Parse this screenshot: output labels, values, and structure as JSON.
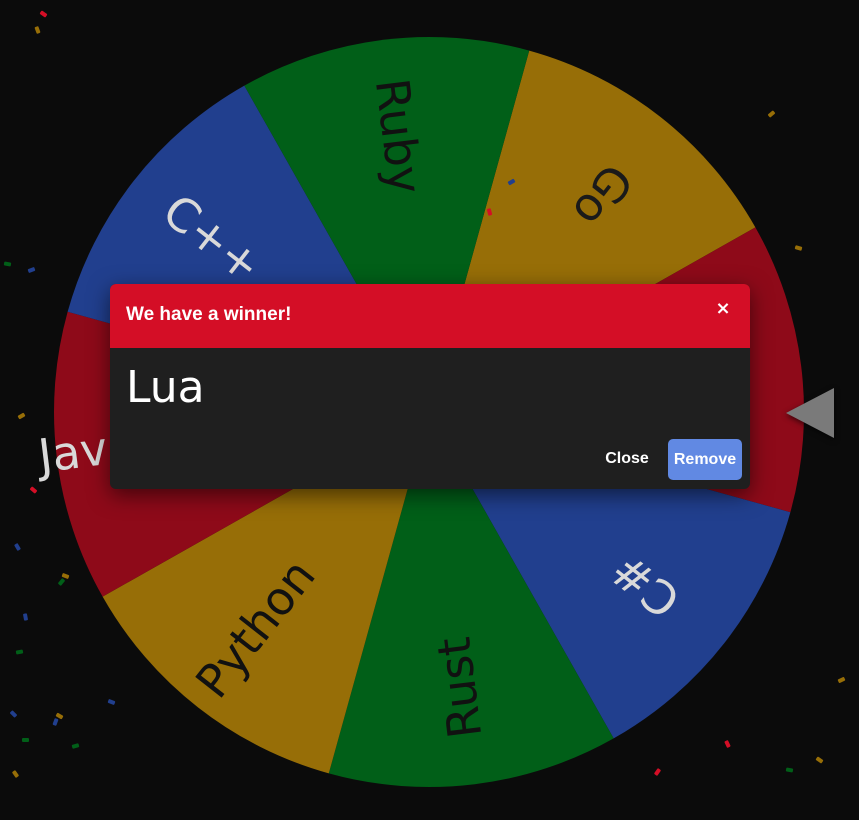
{
  "wheel": {
    "segments": [
      {
        "label": "Go",
        "color": "#976e07",
        "text_color": "#1a1a1a"
      },
      {
        "label": "Lua",
        "color": "#8e0a19",
        "text_color": "#d9d9d9"
      },
      {
        "label": "C#",
        "color": "#213f8e",
        "text_color": "#d9d9d9"
      },
      {
        "label": "Rust",
        "color": "#015f18",
        "text_color": "#111111"
      },
      {
        "label": "Python",
        "color": "#976e07",
        "text_color": "#111111"
      },
      {
        "label": "JavaScript",
        "color": "#8e0a19",
        "text_color": "#d9d9d9"
      },
      {
        "label": "C++",
        "color": "#213f8e",
        "text_color": "#d9d9d9"
      },
      {
        "label": "Ruby",
        "color": "#015f18",
        "text_color": "#111111"
      }
    ],
    "pointer_icon": "triangle-pointer-icon"
  },
  "modal": {
    "title": "We have a winner!",
    "close_icon": "×",
    "winner": "Lua",
    "close_label": "Close",
    "remove_label": "Remove",
    "header_color": "#d40e26",
    "remove_color": "#6189e3"
  }
}
